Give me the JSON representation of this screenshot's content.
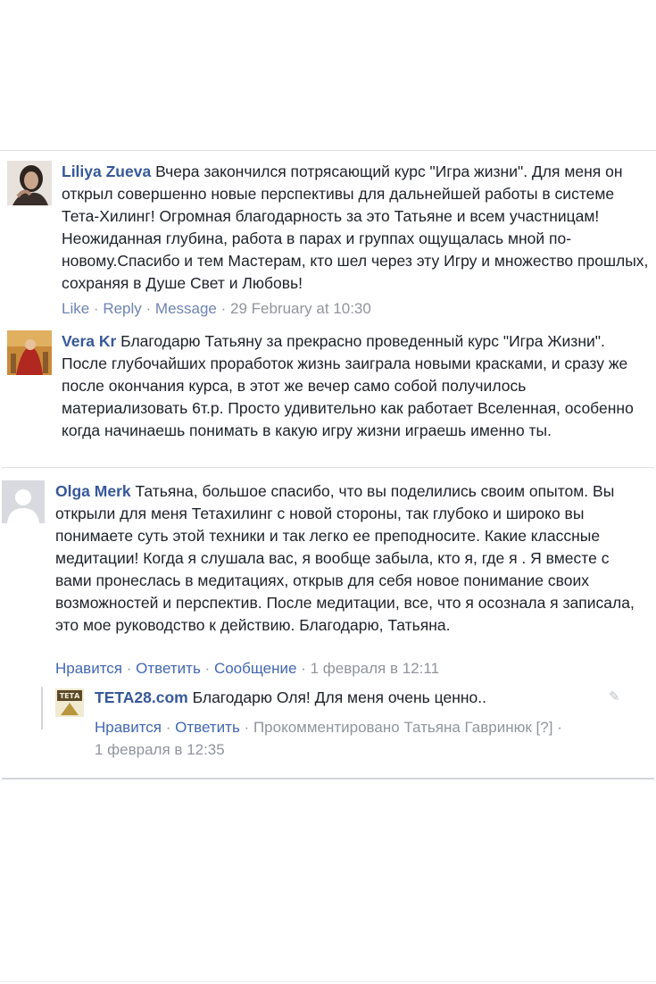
{
  "comments": [
    {
      "author": "Liliya Zueva",
      "text": "Вчера закончился потрясающий курс \"Игра жизни\". Для меня он открыл совершенно новые перспективы для дальнейшей работы в системе Тета-Хилинг! Огромная благодарность за это Татьяне и всем участницам! Неожиданная глубина, работа в парах и группах ощущалась мной по-новому.Спасибо и тем Мастерам, кто шел через эту Игру и множество прошлых, сохраняя в Душе Свет и Любовь!",
      "actions": {
        "like": "Like",
        "reply": "Reply",
        "message": "Message",
        "time": "29 February at 10:30"
      }
    },
    {
      "author": "Vera Kr",
      "text": "Благодарю Татьяну за прекрасно проведенный курс \"Игра Жизни\". После глубочайших проработок жизнь заиграла новыми красками, и сразу же после окончания курса, в этот же вечер само собой получилось материализовать 6т.р. Просто удивительно как работает Вселенная, особенно когда начинаешь понимать в какую игру жизни играешь именно ты."
    },
    {
      "author": "Olga Merk",
      "text": "Татьяна, большое спасибо, что вы поделились своим опытом. Вы открыли для меня Тетахилинг с новой стороны, так глубоко и широко вы понимаете суть этой техники и так легко ее преподносите. Какие классные медитации! Когда я слушала вас, я вообще забыла, кто я, где я . Я вместе с вами пронеслась в медитациях, открыв для себя новое понимание своих возможностей и перспектив. После медитации, все, что я осознала я записала, это мое руководство к действию. Благодарю, Татьяна.",
      "actions": {
        "like": "Нравится",
        "reply": "Ответить",
        "message": "Сообщение",
        "time": "1 февраля в 12:11"
      }
    }
  ],
  "reply": {
    "author": "TETA28.com",
    "avatar_text": "ТЕТА",
    "text": "Благодарю Оля! Для меня очень ценно..",
    "actions": {
      "like": "Нравится",
      "reply": "Ответить",
      "commented_by": "Прокомментировано Татьяна Гавринюк",
      "help": "[?]",
      "time": "1 февраля в 12:35"
    }
  },
  "icons": {
    "edit": "pencil-icon",
    "default_avatar": "default-avatar-icon"
  },
  "colors": {
    "author": "#365899",
    "link": "#4267b2",
    "meta": "#90949c"
  }
}
